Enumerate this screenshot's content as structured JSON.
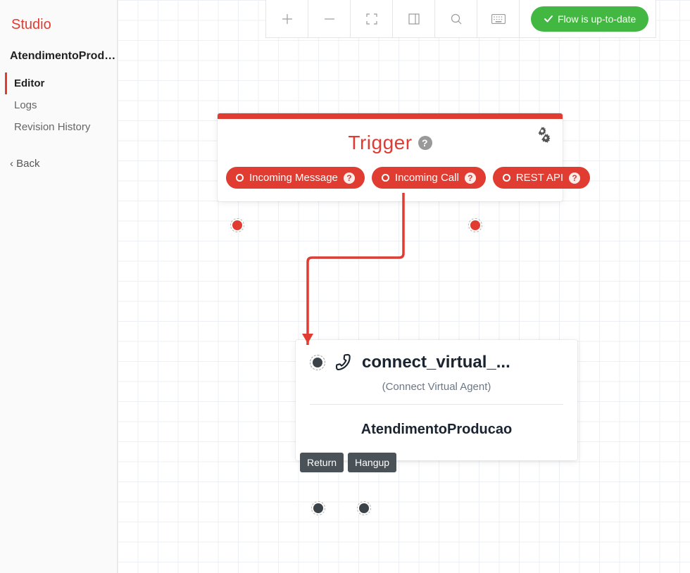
{
  "brand": "Studio",
  "flow_name": "AtendimentoProducao",
  "sidebar": {
    "items": [
      "Editor",
      "Logs",
      "Revision History"
    ],
    "active_index": 0,
    "back_label": "Back"
  },
  "toolbar": {
    "status_label": "Flow is up-to-date"
  },
  "trigger": {
    "title": "Trigger",
    "outputs": [
      "Incoming Message",
      "Incoming Call",
      "REST API"
    ]
  },
  "widget": {
    "title": "connect_virtual_...",
    "subtitle": "(Connect Virtual Agent)",
    "body": "AtendimentoProducao",
    "outputs": [
      "Return",
      "Hangup"
    ]
  }
}
